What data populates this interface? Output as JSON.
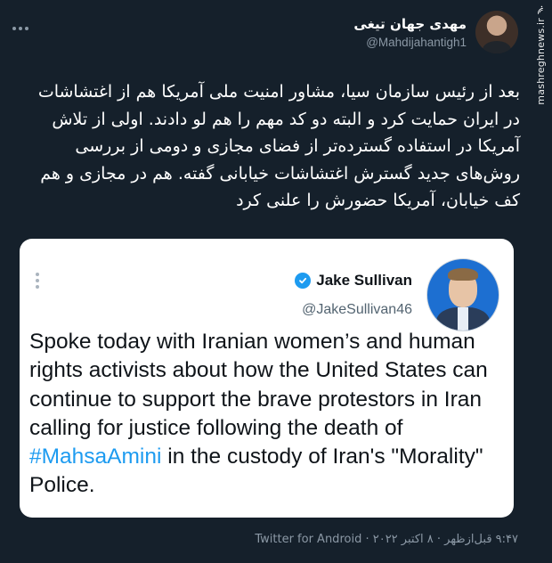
{
  "tweet": {
    "author_name": "مهدی جهان تیغی",
    "author_handle": "@Mahdijahantigh1",
    "text": "بعد از رئیس سازمان سیا، مشاور امنیت ملی آمریکا هم از اغتشاشات در ایران حمایت کرد و البته دو کد مهم را هم لو دادند. اولی از تلاش آمریکا در استفاده گسترده‌تر از فضای مجازی و دومی از بررسی روش‌های جدید گسترش اغتشاشات خیابانی گفته. هم در مجازی و هم کف خیابان، آمریکا حضورش را علنی کرد",
    "footer": "۹:۴۷ قبل‌ازظهر · ۸ اکتبر ۲۰۲۲ · Twitter for Android"
  },
  "quoted_tweet": {
    "author_name": "Jake Sullivan",
    "author_handle": "@JakeSullivan46",
    "verified": true,
    "text_before": "Spoke today with Iranian women’s and human rights activists about how the United States can continue to support the brave protestors in Iran calling for justice following the death of ",
    "hashtag": "#MahsaAmini",
    "text_after": " in the custody of Iran's \"Morality\" Police."
  },
  "watermark": {
    "text": "mashreghnews.ir",
    "logo": "mashregh-logo"
  },
  "icons": {
    "more": "more-dots-icon",
    "verified": "verified-badge-icon",
    "kebab": "kebab-menu-icon"
  },
  "colors": {
    "background": "#15202b",
    "muted": "#8b98a5",
    "link": "#1d9bf0",
    "card": "#ffffff"
  }
}
